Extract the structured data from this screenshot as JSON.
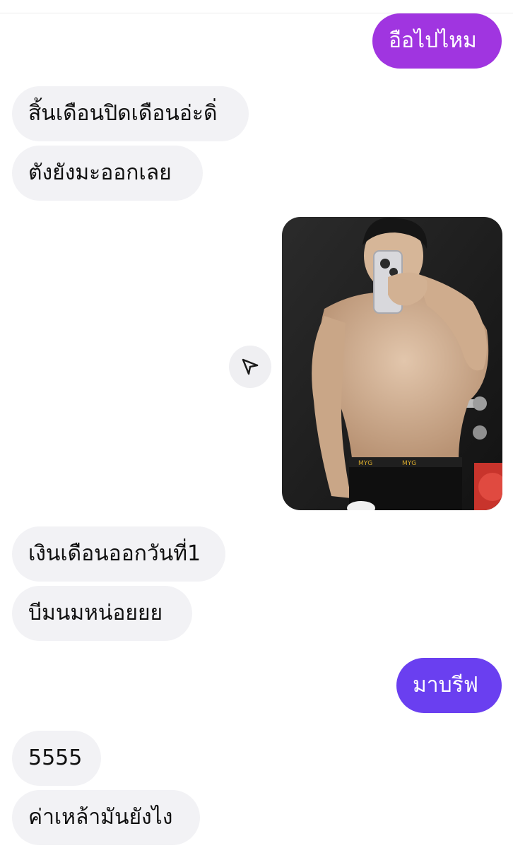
{
  "colors": {
    "sent_top": "#a035e0",
    "sent_bottom": "#6a3ff0",
    "received_bg": "#f2f2f5",
    "share_button_bg": "#efeff2"
  },
  "messages": [
    {
      "direction": "sent",
      "text": "อือไปไหม"
    },
    {
      "direction": "received",
      "text": "สิ้นเดือนปิดเดือนอ่ะดิ่"
    },
    {
      "direction": "received",
      "text": "ตังยังมะออกเลย"
    },
    {
      "direction": "sent",
      "type": "photo",
      "alt": "mirror selfie photo",
      "share_icon": "send-icon"
    },
    {
      "direction": "received",
      "text": "เงินเดือนออกวันที่1"
    },
    {
      "direction": "received",
      "text": "บีมนมหน่อยยย"
    },
    {
      "direction": "sent",
      "text": "มาบรีฟ"
    },
    {
      "direction": "received",
      "text": "5555"
    },
    {
      "direction": "received",
      "text": "ค่าเหล้ามันยังไง"
    }
  ]
}
